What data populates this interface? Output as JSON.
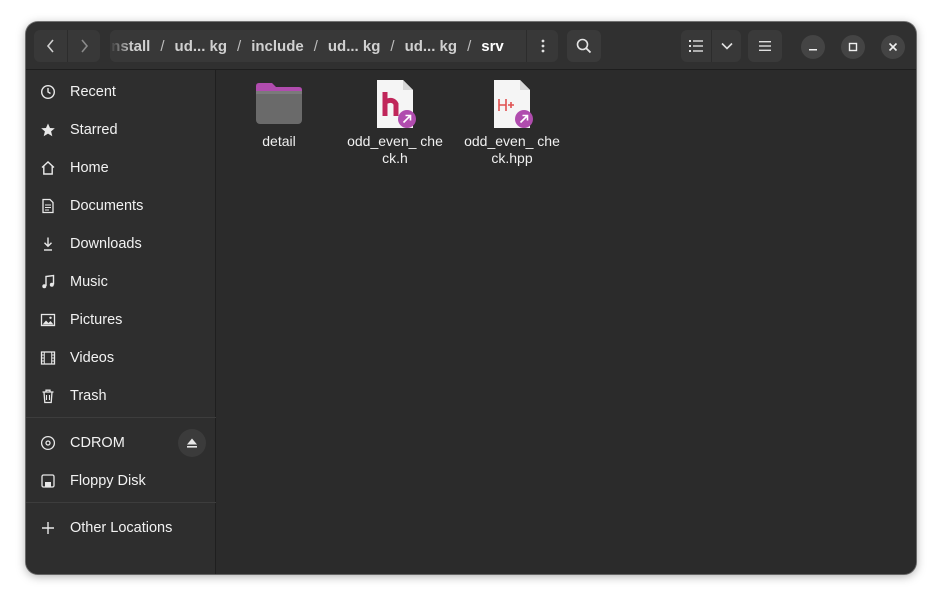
{
  "toolbar": {
    "back_icon": "chevron-left-icon",
    "forward_icon": "chevron-right-icon",
    "search_icon": "search-icon",
    "view_list_icon": "list-view-icon",
    "view_dropdown_icon": "chevron-down-icon",
    "main_menu_icon": "hamburger-menu-icon"
  },
  "path": {
    "crumbs": [
      "install",
      "ud... kg",
      "include",
      "ud... kg",
      "ud... kg",
      "srv"
    ]
  },
  "window_controls": {
    "minimize": "minimize-icon",
    "maximize": "maximize-icon",
    "close": "close-icon"
  },
  "sidebar": {
    "items": [
      {
        "label": "Recent",
        "icon": "clock-icon"
      },
      {
        "label": "Starred",
        "icon": "star-icon"
      },
      {
        "label": "Home",
        "icon": "home-icon"
      },
      {
        "label": "Documents",
        "icon": "document-icon"
      },
      {
        "label": "Downloads",
        "icon": "download-icon"
      },
      {
        "label": "Music",
        "icon": "music-icon"
      },
      {
        "label": "Pictures",
        "icon": "picture-icon"
      },
      {
        "label": "Videos",
        "icon": "video-icon"
      },
      {
        "label": "Trash",
        "icon": "trash-icon"
      }
    ],
    "devices": [
      {
        "label": "CDROM",
        "icon": "disc-icon",
        "action_icon": "eject-icon"
      },
      {
        "label": "Floppy Disk",
        "icon": "floppy-icon"
      }
    ],
    "other": {
      "label": "Other Locations",
      "icon": "plus-icon"
    }
  },
  "files": [
    {
      "name": "detail",
      "type": "folder",
      "color": "#b04cae"
    },
    {
      "name": "odd_even_ check.h",
      "type": "header-symlink",
      "badge": "h",
      "badge_color": "#c0265a"
    },
    {
      "name": "odd_even_ check.hpp",
      "type": "header-symlink",
      "badge": "H+",
      "badge_color": "#e05050"
    }
  ],
  "colors": {
    "accent_purple": "#b04cae",
    "window_bg": "#2b2b2b",
    "sidebar_bg": "#2e2e2e"
  }
}
